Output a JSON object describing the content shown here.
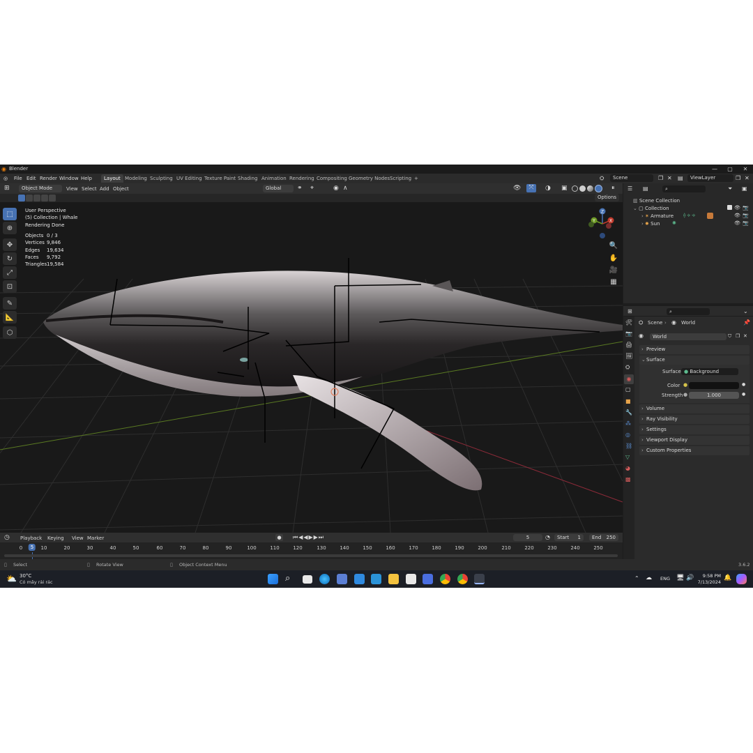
{
  "window": {
    "title": "Blender",
    "minimize": "—",
    "maximize": "▢",
    "close": "✕"
  },
  "menu": [
    "File",
    "Edit",
    "Render",
    "Window",
    "Help"
  ],
  "workspaces": [
    "Layout",
    "Modeling",
    "Sculpting",
    "UV Editing",
    "Texture Paint",
    "Shading",
    "Animation",
    "Rendering",
    "Compositing",
    "Geometry Nodes",
    "Scripting",
    "+"
  ],
  "scene": {
    "name": "Scene",
    "view_layer": "ViewLayer"
  },
  "viewport_header": {
    "mode": "Object Mode",
    "menus": [
      "View",
      "Select",
      "Add",
      "Object"
    ],
    "transform": "Global",
    "options": "Options"
  },
  "viewport_info": {
    "line1": "User Perspective",
    "line2": "(5) Collection | Whale",
    "line3": "Rendering Done"
  },
  "stats": [
    {
      "label": "Objects",
      "value": "0 / 3"
    },
    {
      "label": "Vertices",
      "value": "9,846"
    },
    {
      "label": "Edges",
      "value": "19,634"
    },
    {
      "label": "Faces",
      "value": "9,792"
    },
    {
      "label": "Triangles",
      "value": "19,584"
    }
  ],
  "gizmo": {
    "x": "X",
    "y": "Y",
    "z": "Z"
  },
  "outliner": {
    "root": "Scene Collection",
    "collection": "Collection",
    "items": [
      "Armature",
      "Sun"
    ]
  },
  "properties": {
    "breadcrumb_scene": "Scene",
    "breadcrumb_world": "World",
    "world_name": "World",
    "panels": {
      "preview": "Preview",
      "surface": "Surface",
      "volume": "Volume",
      "ray_visibility": "Ray Visibility",
      "settings": "Settings",
      "viewport_display": "Viewport Display",
      "custom_properties": "Custom Properties"
    },
    "surface_label": "Surface",
    "surface_value": "Background",
    "color_label": "Color",
    "strength_label": "Strength",
    "strength_value": "1.000"
  },
  "timeline": {
    "menus": [
      "Playback",
      "Keying",
      "View",
      "Marker"
    ],
    "current_frame": "5",
    "start_label": "Start",
    "start_value": "1",
    "end_label": "End",
    "end_value": "250",
    "ticks": [
      "0",
      "5",
      "10",
      "20",
      "30",
      "40",
      "50",
      "60",
      "70",
      "80",
      "90",
      "100",
      "110",
      "120",
      "130",
      "140",
      "150",
      "160",
      "170",
      "180",
      "190",
      "200",
      "210",
      "220",
      "230",
      "240",
      "250"
    ]
  },
  "statusbar": {
    "select": "Select",
    "rotate": "Rotate View",
    "context": "Object Context Menu",
    "version": "3.6.2"
  },
  "taskbar": {
    "weather_temp": "30°C",
    "weather_desc": "Có mây rải rác",
    "lang": "ENG",
    "time": "9:58 PM",
    "date": "7/13/2024"
  }
}
